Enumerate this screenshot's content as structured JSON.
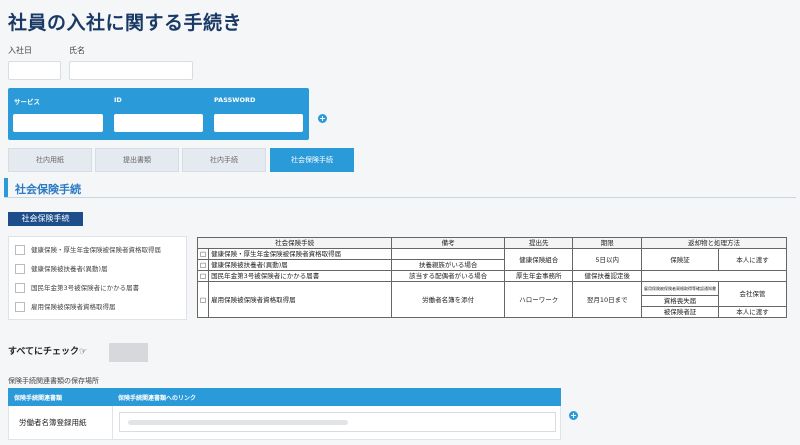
{
  "page": {
    "title": "社員の入社に関する手続き"
  },
  "form": {
    "join_date_label": "入社日",
    "name_label": "氏名"
  },
  "services": {
    "col_service": "サービス",
    "col_id": "ID",
    "col_password": "PASSWORD",
    "add": "+"
  },
  "tabs": [
    {
      "label": "社内用紙",
      "active": false
    },
    {
      "label": "提出書類",
      "active": false
    },
    {
      "label": "社内手続",
      "active": false
    },
    {
      "label": "社会保険手続",
      "active": true
    }
  ],
  "section": {
    "title": "社会保険手続",
    "badge": "社会保険手続"
  },
  "checklist": [
    "健康保険・厚生年金保険被保険者資格取得届",
    "健康保険被扶養者(異動)届",
    "国民年金第3号被保険者にかかる届書",
    "雇用保険被保険者資格取得届"
  ],
  "table": {
    "headers": [
      "社会保険手続",
      "備考",
      "提出先",
      "期限",
      "返却物と処理方法"
    ],
    "rows": [
      {
        "mark": "□",
        "name": "健康保険・厚生年金保険被保険者資格取得届"
      },
      {
        "mark": "□",
        "name": "健康保険被扶養者(異動)届",
        "note": "扶養親族がいる場合"
      },
      {
        "mark": "□",
        "name": "国民年金第3号被保険者にかかる届書",
        "note": "該当する配偶者がいる場合",
        "dest": "厚生年金事務所",
        "deadline": "健保扶養認定後"
      },
      {
        "mark": "□",
        "name": "雇用保険被保険者資格取得届",
        "note": "労働者名簿を添付",
        "dest": "ハローワーク",
        "deadline": "翌月10日まで"
      }
    ],
    "merged": {
      "dest_health": "健康保険組合",
      "deadline_5days": "5日以内",
      "return_card": "保険証",
      "process_hand": "本人に渡す",
      "small_note": "雇用保険被保険者資格取得等確認通知書",
      "return_loss": "資格喪失届",
      "process_keep": "会社保管",
      "return_cert": "被保険者証",
      "process_hand2": "本人に渡す"
    }
  },
  "check_all": {
    "label": "すべてにチェック☞"
  },
  "storage": {
    "caption": "保険手続関連書類の保存場所",
    "col_doc": "保険手続関連書類",
    "col_link": "保険手続関連書類へのリンク",
    "row_name": "労働者名簿登録用紙",
    "add": "+"
  },
  "colors": {
    "accent": "#2b9ad8",
    "navy": "#1d4d8a",
    "title": "#1a3a66"
  }
}
